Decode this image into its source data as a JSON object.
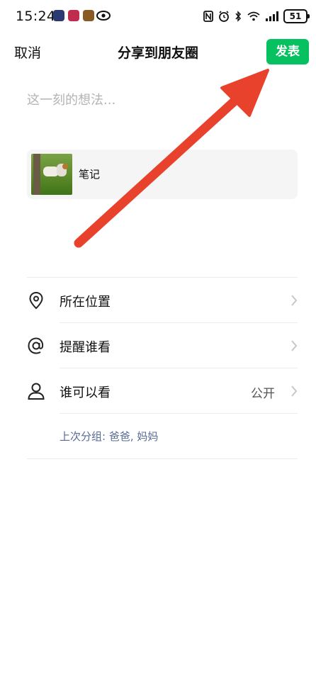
{
  "status_bar": {
    "time": "15:24",
    "battery": "51"
  },
  "header": {
    "cancel_label": "取消",
    "title": "分享到朋友圈",
    "publish_label": "发表"
  },
  "composer": {
    "placeholder": "这一刻的想法..."
  },
  "attachment": {
    "label": "笔记"
  },
  "options": [
    {
      "label": "所在位置",
      "icon": "location-pin-icon",
      "value": ""
    },
    {
      "label": "提醒谁看",
      "icon": "at-sign-icon",
      "value": ""
    },
    {
      "label": "谁可以看",
      "icon": "person-icon",
      "value": "公开"
    }
  ],
  "last_group_note": "上次分组: 爸爸, 妈妈",
  "colors": {
    "accent_green": "#07c160",
    "arrow_red": "#e8412c",
    "link_blue": "#576b95"
  }
}
